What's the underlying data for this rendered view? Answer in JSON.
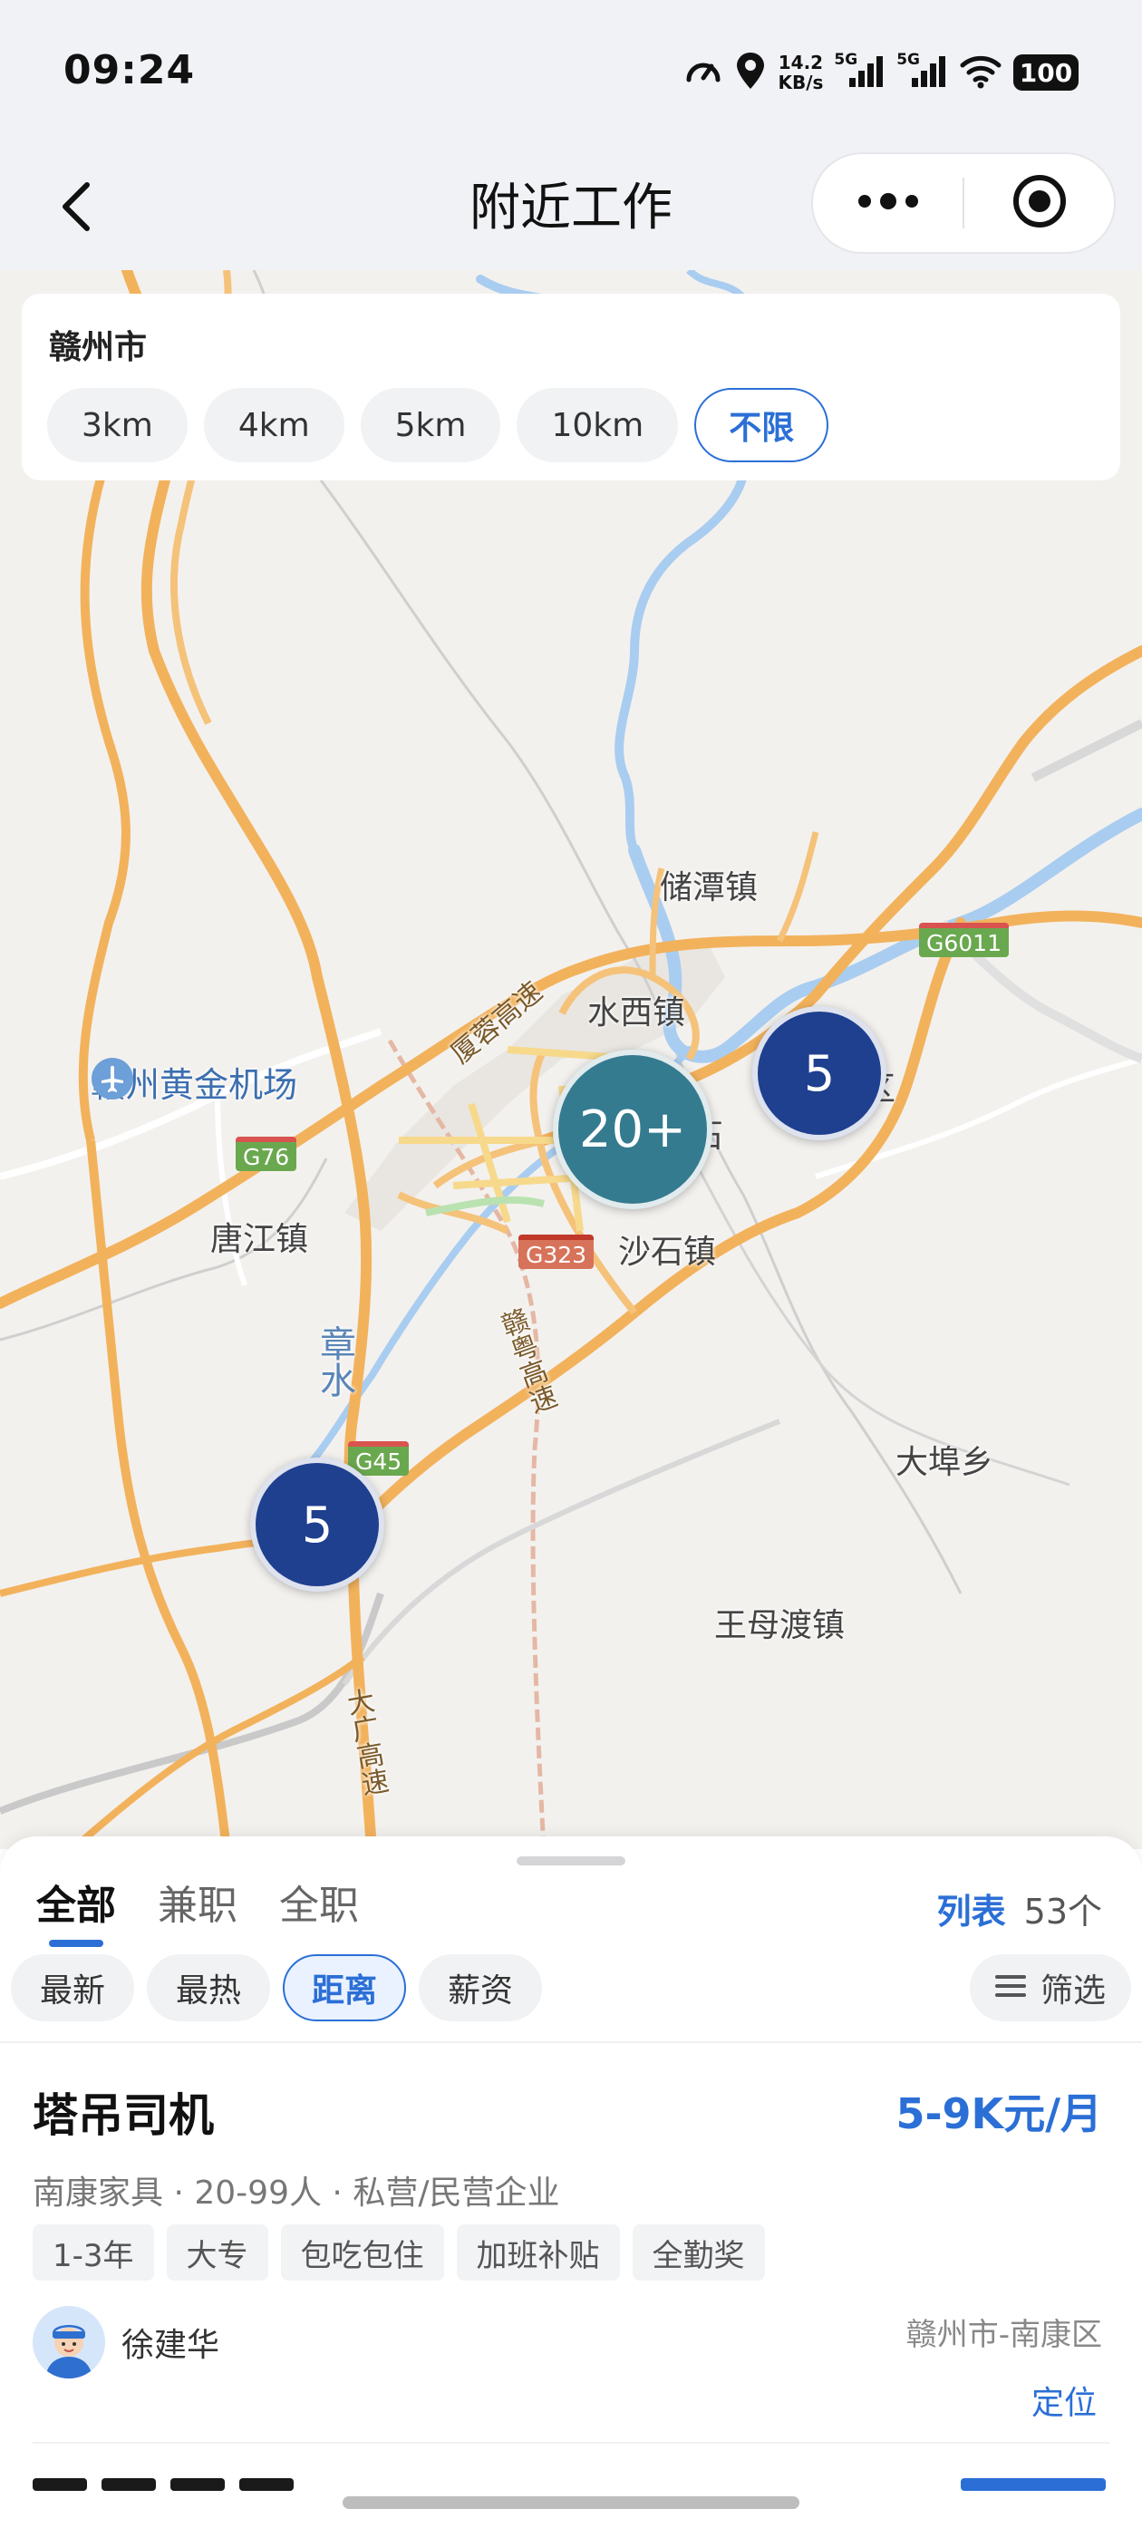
{
  "status_bar": {
    "time": "09:24",
    "net_speed_value": "14.2",
    "net_speed_unit": "KB/s",
    "sim1_label": "5G",
    "sim2_label": "5G",
    "battery": "100",
    "icons": [
      "speedometer-icon",
      "location-pin-icon",
      "signal-icon",
      "signal-icon",
      "wifi-icon",
      "battery-icon"
    ]
  },
  "title_bar": {
    "title": "附近工作",
    "icons": [
      "back-arrow-icon",
      "more-dots-icon",
      "target-close-icon"
    ]
  },
  "distance_filter": {
    "city": "赣州市",
    "options": [
      "3km",
      "4km",
      "5km",
      "10km",
      "不限"
    ],
    "selected": "不限"
  },
  "map": {
    "places": {
      "chutan": "储潭镇",
      "shuixi": "水西镇",
      "airport": "赣州黄金机场",
      "tangjiang": "唐江镇",
      "shashi": "沙石镇",
      "dabu": "大埠乡",
      "wangmudu": "王母渡镇",
      "river": "章水",
      "district_fragment": "区",
      "district_fragment2": "石"
    },
    "roads": {
      "xiaming_expressway": "厦蓉高速",
      "ganyue_expressway": "赣粤高速",
      "daguang_expressway": "大广高速"
    },
    "shields": {
      "g6011": "G6011",
      "g76": "G76",
      "g323": "G323",
      "g45": "G45"
    },
    "clusters": {
      "center": "20+",
      "east": "5",
      "southwest": "5"
    },
    "colors": {
      "cluster_blue": "#1f3f8f",
      "cluster_teal": "#357b8f",
      "road": "#f2b25c",
      "water": "#a9cdf0"
    }
  },
  "sheet": {
    "tabs": [
      "全部",
      "兼职",
      "全职"
    ],
    "active_tab": "全部",
    "list_label": "列表",
    "count": "53个",
    "sort_options": [
      "最新",
      "最热",
      "距离",
      "薪资"
    ],
    "active_sort": "距离",
    "filter_label": "筛选"
  },
  "job": {
    "title": "塔吊司机",
    "salary": "5-9K元/月",
    "company": "南康家具",
    "size": "20-99人",
    "type": "私营/民营企业",
    "tags": [
      "1-3年",
      "大专",
      "包吃包住",
      "加班补贴",
      "全勤奖"
    ],
    "recruiter": "徐建华",
    "location": "赣州市-南康区",
    "locate_label": "定位"
  },
  "accent_color": "#2b6fd6"
}
